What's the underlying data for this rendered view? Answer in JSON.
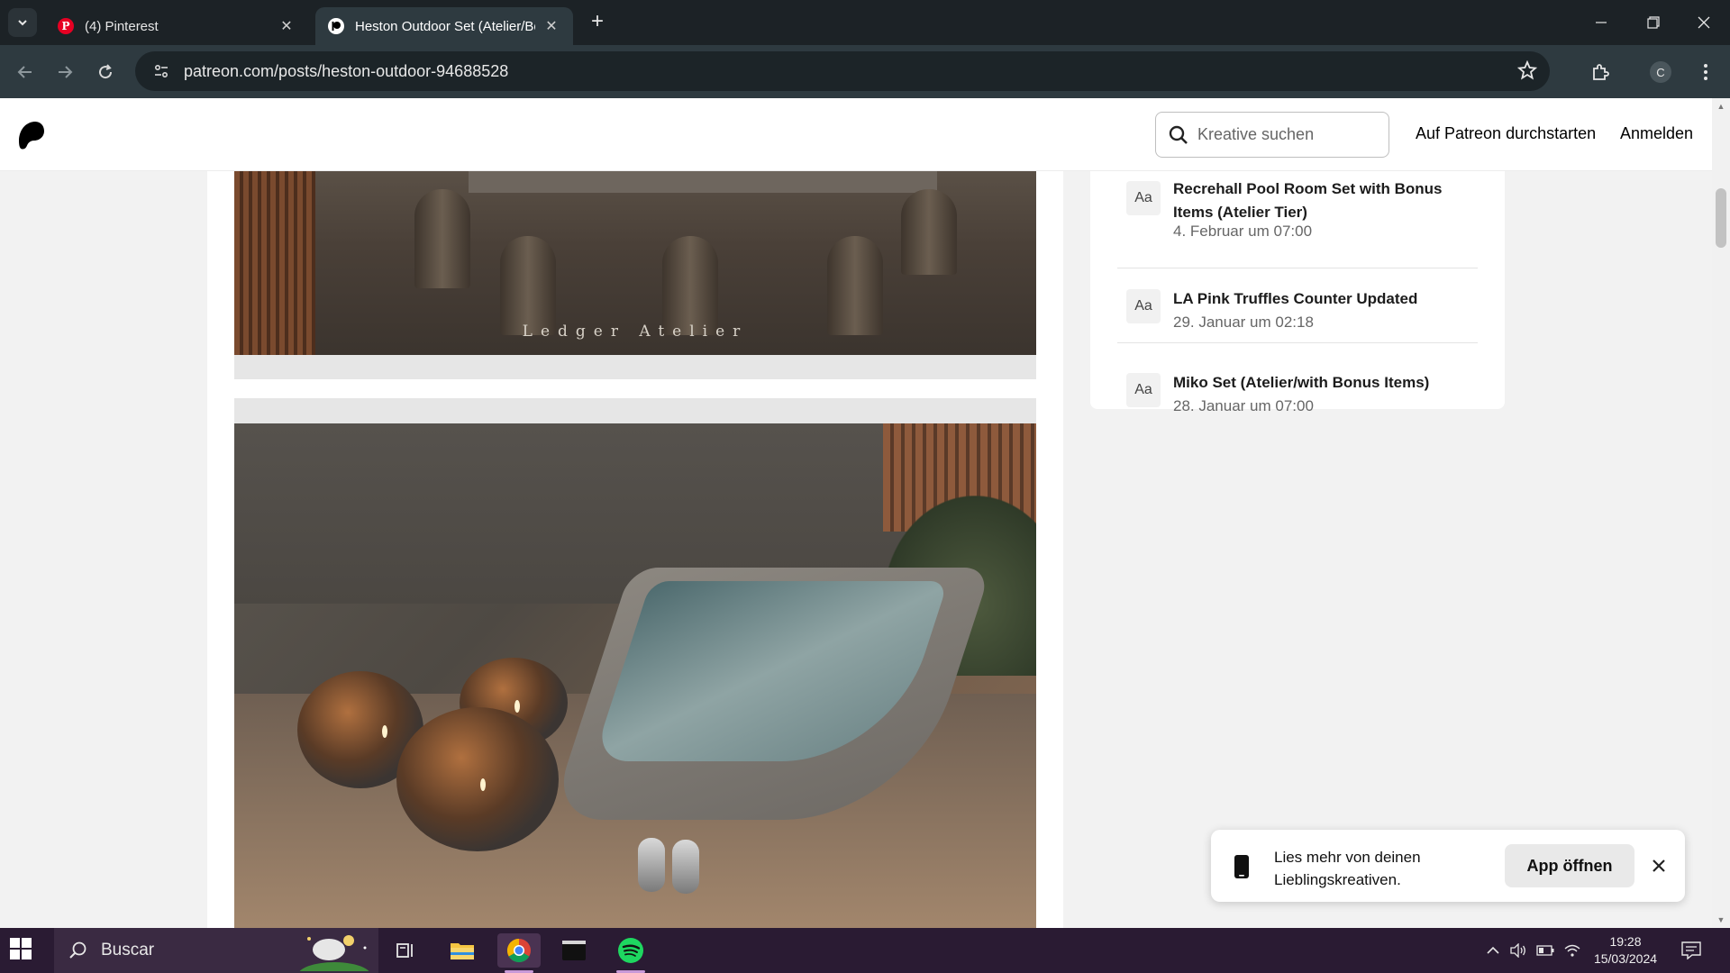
{
  "browser": {
    "tabs": [
      {
        "title": "(4) Pinterest",
        "active": false
      },
      {
        "title": "Heston Outdoor Set (Atelier/Bo",
        "active": true
      }
    ],
    "url": "patreon.com/posts/heston-outdoor-94688528",
    "profile_initial": "C"
  },
  "header": {
    "search_placeholder": "Kreative suchen",
    "start_link": "Auf Patreon durchstarten",
    "login_link": "Anmelden"
  },
  "post": {
    "image_captions": [
      "Ledger Atelier"
    ]
  },
  "sidebar": {
    "posts": [
      {
        "badge": "Aa",
        "title": "Recrehall Pool Room Set with Bonus Items (Atelier Tier)",
        "date": "4. Februar um 07:00"
      },
      {
        "badge": "Aa",
        "title": "LA Pink Truffles Counter Updated",
        "date": "29. Januar um 02:18"
      },
      {
        "badge": "Aa",
        "title": "Miko Set (Atelier/with Bonus Items)",
        "date": "28. Januar um 07:00"
      }
    ]
  },
  "toast": {
    "message": "Lies mehr von deinen Lieblingskreativen.",
    "button": "App öffnen"
  },
  "taskbar": {
    "search_label": "Buscar",
    "time": "19:28",
    "date": "15/03/2024"
  },
  "colors": {
    "titlebar": "#1c2226",
    "toolbar": "#2e3a40",
    "taskbar": "#2a1b33",
    "pinterest": "#e60023",
    "spotify": "#1ed760"
  }
}
